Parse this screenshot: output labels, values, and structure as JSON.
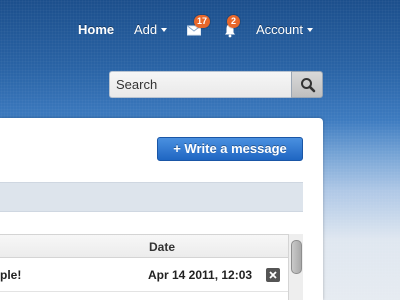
{
  "nav": {
    "home_label": "Home",
    "add_label": "Add",
    "account_label": "Account",
    "mail_badge": "17",
    "notifications_badge": "2",
    "icons": {
      "mail": "envelope-icon",
      "notifications": "bell-icon"
    }
  },
  "search": {
    "placeholder": "Search",
    "icon": "magnifier-icon"
  },
  "messages": {
    "write_button_label": "+ Write a message",
    "columns": {
      "date": "Date"
    },
    "rows": [
      {
        "subject": "ple!",
        "date": "Apr 14 2011, 12:03"
      }
    ]
  },
  "colors": {
    "accent_blue": "#2a6fcb",
    "badge_orange": "#e8672a",
    "header_blue": "#1c4f8c"
  }
}
